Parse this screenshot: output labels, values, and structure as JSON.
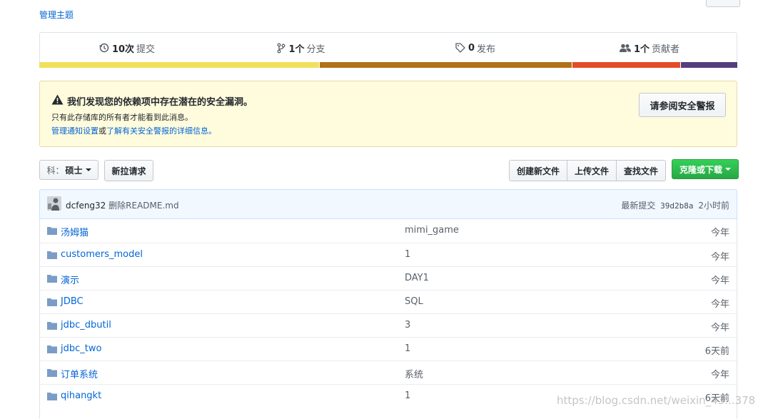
{
  "topics": {
    "manage_label": "管理主题"
  },
  "summary": {
    "commits": {
      "count": "10次",
      "label": "提交"
    },
    "branches": {
      "count": "1个",
      "label": "分支"
    },
    "releases": {
      "count": "0",
      "label": "发布"
    },
    "contributors": {
      "count": "1个",
      "label": "贡献者"
    }
  },
  "language_bar": [
    {
      "color": "#f1e05a",
      "fraction": 0.402
    },
    {
      "color": "#b07219",
      "fraction": 0.362
    },
    {
      "color": "#e34c26",
      "fraction": 0.155
    },
    {
      "color": "#563d7c",
      "fraction": 0.081
    }
  ],
  "alert": {
    "title": "我们发现您的依赖项中存在潜在的安全漏洞。",
    "line2": "只有此存储库的所有者才能看到此消息。",
    "line3_link1": "管理通知设置",
    "line3_mid": "或",
    "line3_link2": "了解有关安全警报的详细信息。",
    "button": "请参阅安全警报"
  },
  "toolbar": {
    "branch_prefix": "科：",
    "branch_name": "硕士",
    "new_pr": "新拉请求",
    "create_file": "创建新文件",
    "upload_files": "上传文件",
    "find_file": "查找文件",
    "clone": "克隆或下载"
  },
  "commit": {
    "author": "dcfeng32",
    "message": "删除README.md",
    "latest_label": "最新提交",
    "sha": "39d2b8a",
    "time": "2小时前"
  },
  "files": [
    {
      "name": "汤姆猫",
      "message": "mimi_game",
      "age": "今年"
    },
    {
      "name": "customers_model",
      "message": "1",
      "age": "今年"
    },
    {
      "name": "演示",
      "message": "DAY1",
      "age": "今年"
    },
    {
      "name": "JDBC",
      "message": "SQL",
      "age": "今年"
    },
    {
      "name": "jdbc_dbutil",
      "message": "3",
      "age": "今年"
    },
    {
      "name": "jdbc_two",
      "message": "1",
      "age": "6天前"
    },
    {
      "name": "订单系统",
      "message": "系统",
      "age": "今年"
    },
    {
      "name": "qihangkt",
      "message": "1",
      "age": "6天前"
    }
  ],
  "watermark": "https://blog.csdn.net/weixin_43...378",
  "icons": {
    "commits": "history-icon",
    "branches": "git-branch-icon",
    "releases": "tag-icon",
    "contributors": "people-icon",
    "alert": "alert-triangle-icon",
    "folder": "folder-icon"
  }
}
